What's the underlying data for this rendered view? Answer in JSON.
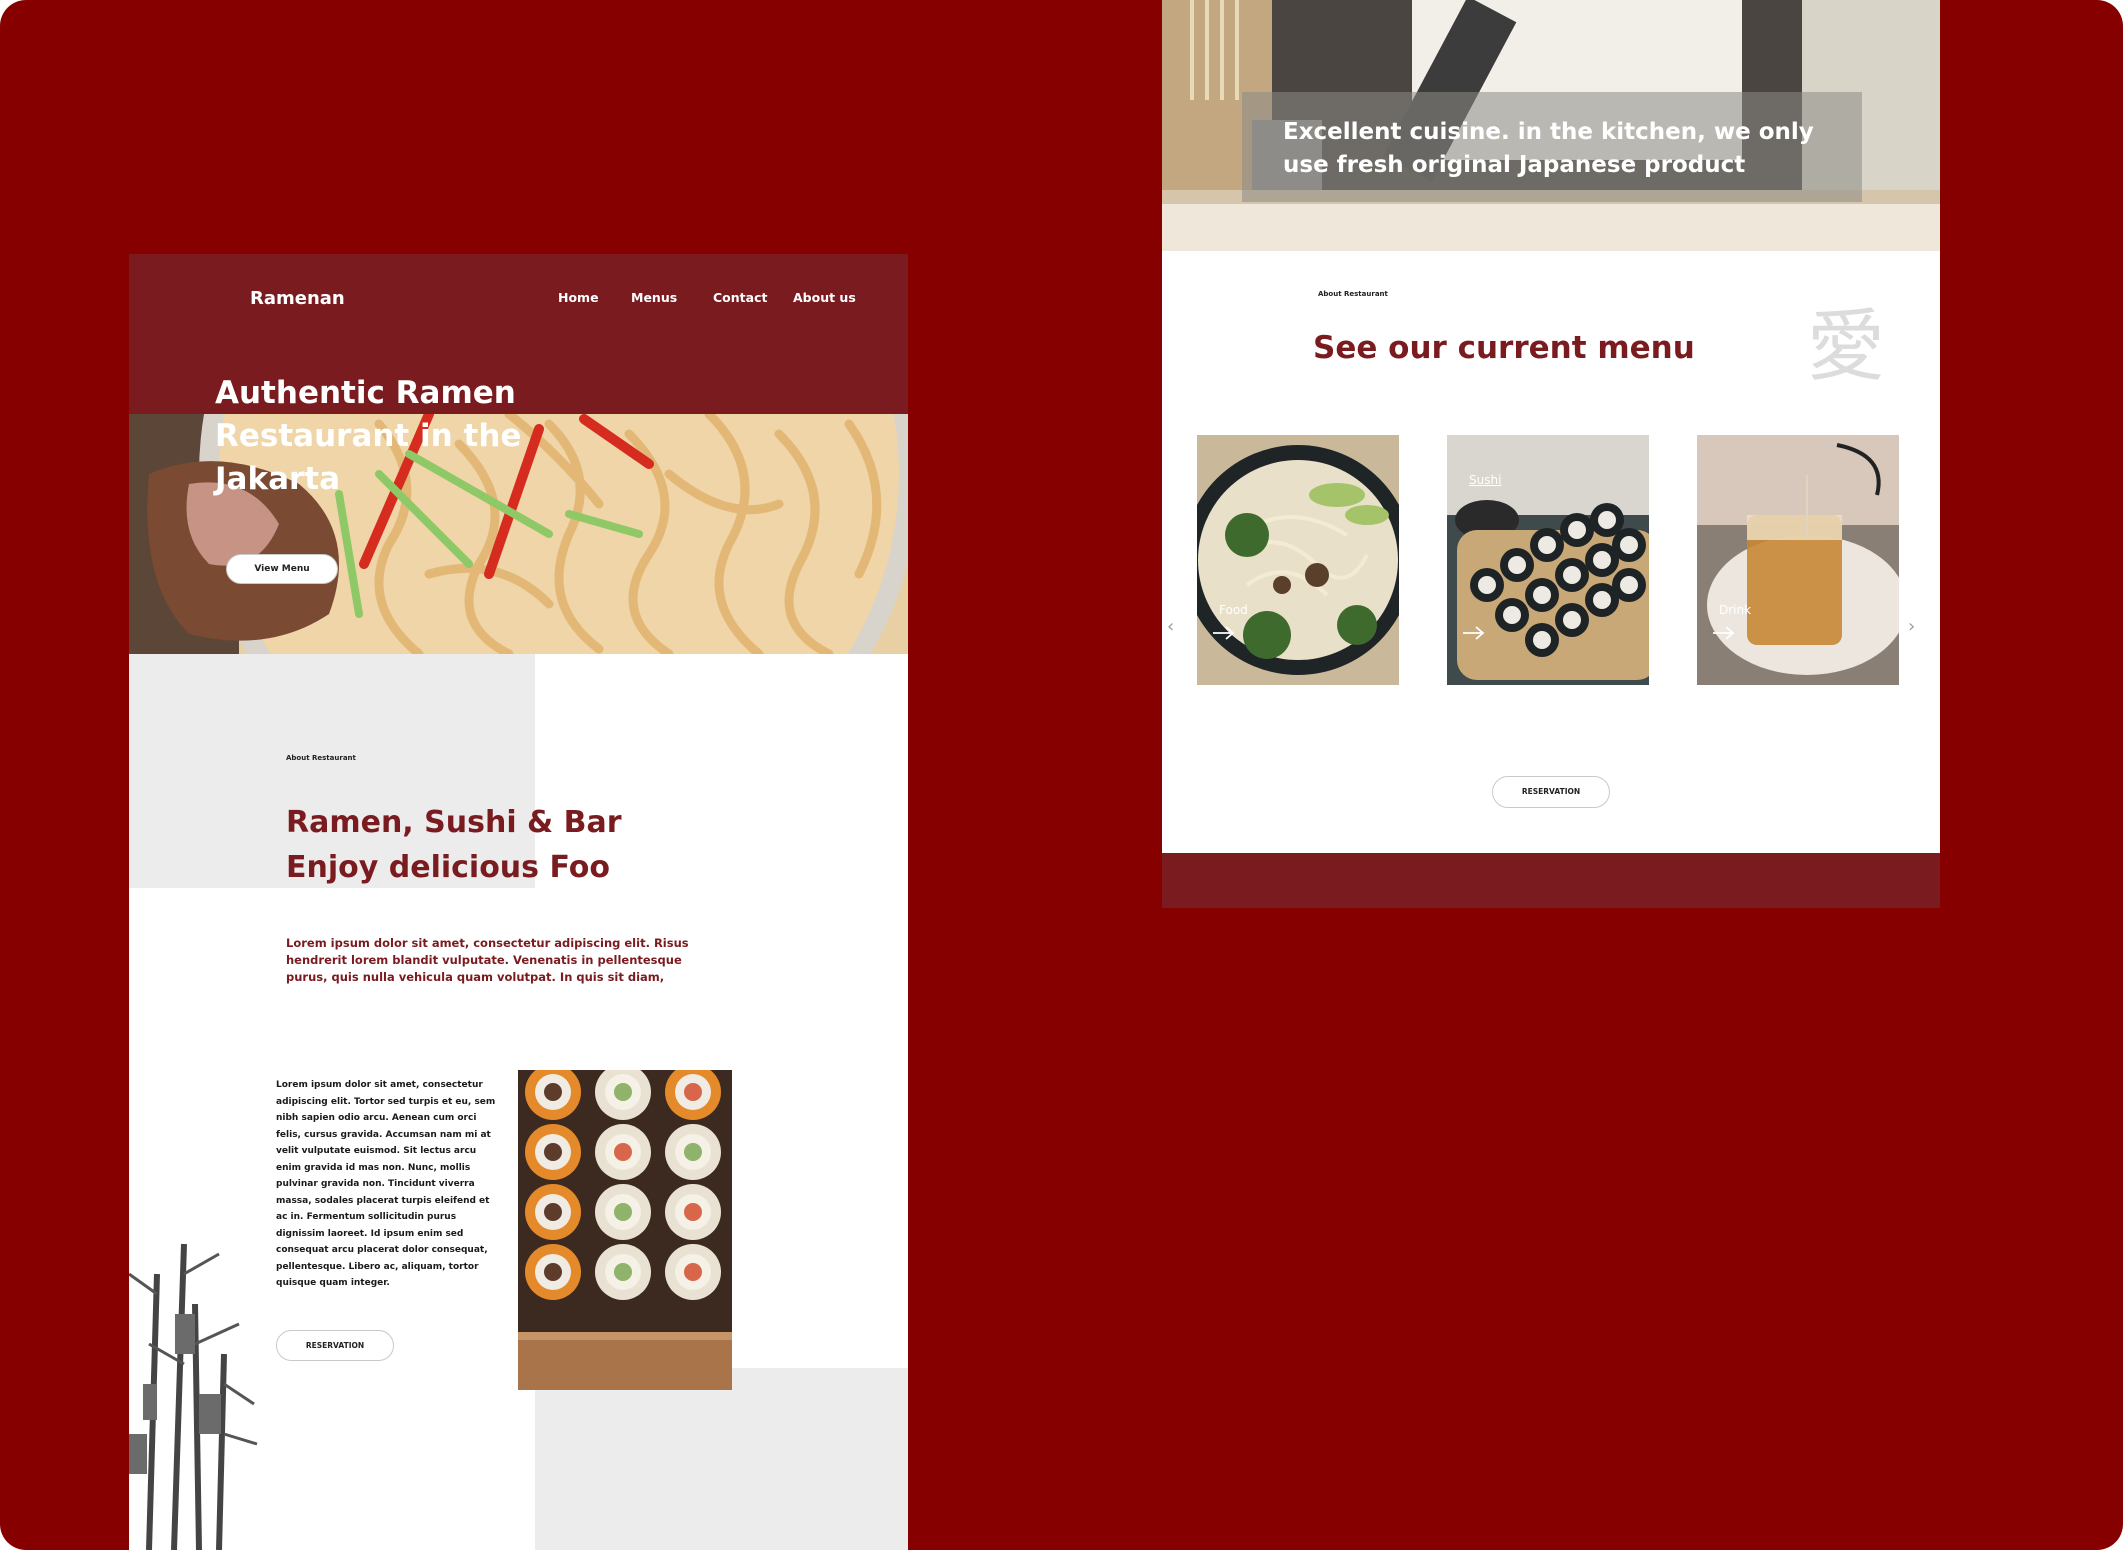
{
  "left_page": {
    "header": {
      "brand": "Ramenan",
      "nav": [
        {
          "label": "Home"
        },
        {
          "label": "Menus"
        },
        {
          "label": "Contact"
        },
        {
          "label": "About us"
        }
      ]
    },
    "hero": {
      "title": "Authentic Ramen Restaurant in the Jakarta",
      "cta_label": "View Menu"
    },
    "about": {
      "eyebrow": "About Restaurant",
      "title_line1": "Ramen, Sushi & Bar",
      "title_line2": "Enjoy delicious Foo",
      "lead": "Lorem ipsum dolor sit amet, consectetur adipiscing elit. Risus hendrerit lorem blandit vulputate. Venenatis in pellentesque purus, quis nulla vehicula quam volutpat. In quis sit diam,",
      "body": "Lorem ipsum dolor sit amet, consectetur adipiscing elit. Tortor sed turpis et eu, sem nibh sapien odio arcu. Aenean cum orci felis, cursus gravida. Accumsan nam mi at velit vulputate euismod. Sit lectus arcu enim gravida id mas non. Nunc, mollis pulvinar gravida non. Tincidunt viverra massa, sodales placerat turpis eleifend et ac in. Fermentum sollicitudin purus dignissim laoreet. Id ipsum enim sed consequat arcu placerat dolor consequat, pellentesque. Libero ac, aliquam, tortor quisque quam integer.",
      "cta_label": "RESERVATION"
    }
  },
  "right_page": {
    "banner_text": "Excellent cuisine. in the kitchen, we only use fresh original Japanese product",
    "eyebrow": "About Restaurant",
    "menu_title": "See our current menu",
    "kanji": "愛",
    "cards": [
      {
        "label": "Food"
      },
      {
        "label": "Sushi"
      },
      {
        "label": "Drink"
      }
    ],
    "cta_label": "RESERVATION"
  },
  "icons": {
    "prev": "chevron-left-icon",
    "next": "chevron-right-icon",
    "arrow": "arrow-right-icon"
  },
  "colors": {
    "background": "#870000",
    "brand_red": "#7a1b1f",
    "light_grey": "#ececec"
  }
}
